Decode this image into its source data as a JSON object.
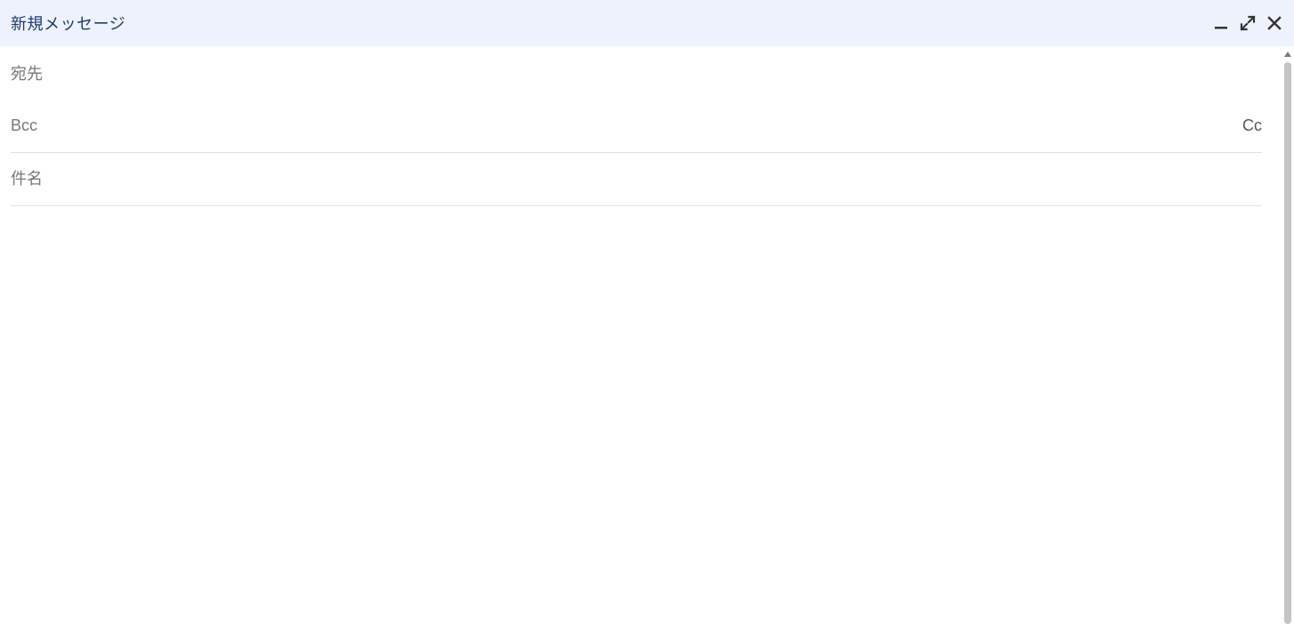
{
  "header": {
    "title": "新規メッセージ"
  },
  "fields": {
    "to_label": "宛先",
    "bcc_label": "Bcc",
    "cc_link": "Cc",
    "subject_placeholder": "件名"
  }
}
